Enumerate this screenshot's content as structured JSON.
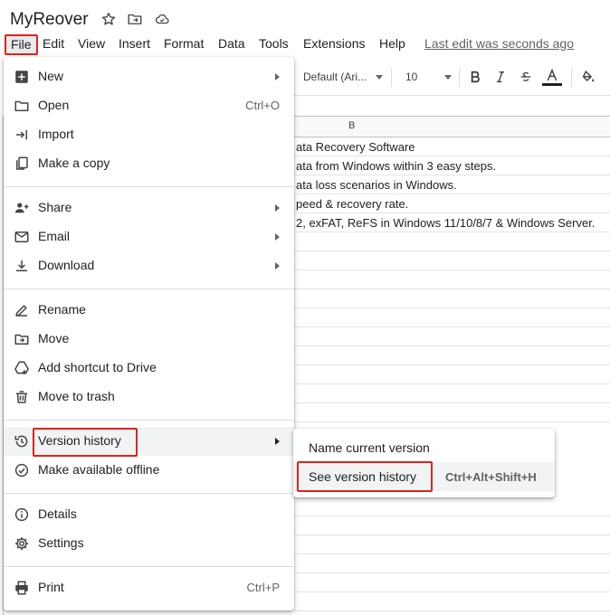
{
  "title_bar": {
    "doc_title": "MyReover",
    "icons": [
      "star-icon",
      "move-to-folder-icon",
      "cloud-status-icon"
    ]
  },
  "menubar": {
    "items": [
      "File",
      "Edit",
      "View",
      "Insert",
      "Format",
      "Data",
      "Tools",
      "Extensions",
      "Help"
    ],
    "last_edit": "Last edit was seconds ago"
  },
  "toolbar": {
    "font": "Default (Ari...",
    "font_size": "10",
    "text_color_accent": "#202124"
  },
  "sheet": {
    "column_header": "B",
    "rows": [
      "ata Recovery Software",
      "ata from Windows within 3 easy steps.",
      "ata loss scenarios in Windows.",
      "peed & recovery rate.",
      "2, exFAT, ReFS in Windows 11/10/8/7 & Windows Server."
    ]
  },
  "file_menu": {
    "items": [
      {
        "label": "New",
        "icon": "new-plus-icon",
        "submenu": true
      },
      {
        "label": "Open",
        "icon": "folder-icon",
        "shortcut": "Ctrl+O"
      },
      {
        "label": "Import",
        "icon": "import-icon"
      },
      {
        "label": "Make a copy",
        "icon": "copy-icon"
      },
      {
        "label": "Share",
        "icon": "share-person-icon",
        "submenu": true
      },
      {
        "label": "Email",
        "icon": "email-icon",
        "submenu": true
      },
      {
        "label": "Download",
        "icon": "download-icon",
        "submenu": true
      },
      {
        "label": "Rename",
        "icon": "rename-pencil-icon"
      },
      {
        "label": "Move",
        "icon": "move-folder-icon"
      },
      {
        "label": "Add shortcut to Drive",
        "icon": "add-shortcut-drive-icon"
      },
      {
        "label": "Move to trash",
        "icon": "trash-icon"
      },
      {
        "label": "Version history",
        "icon": "history-icon",
        "submenu": true
      },
      {
        "label": "Make available offline",
        "icon": "offline-check-icon"
      },
      {
        "label": "Details",
        "icon": "info-icon"
      },
      {
        "label": "Settings",
        "icon": "settings-gear-icon"
      },
      {
        "label": "Print",
        "icon": "print-icon",
        "shortcut": "Ctrl+P"
      }
    ]
  },
  "version_submenu": {
    "items": [
      {
        "label": "Name current version"
      },
      {
        "label": "See version history",
        "shortcut": "Ctrl+Alt+Shift+H"
      }
    ]
  },
  "highlight_color": "#e0231a"
}
